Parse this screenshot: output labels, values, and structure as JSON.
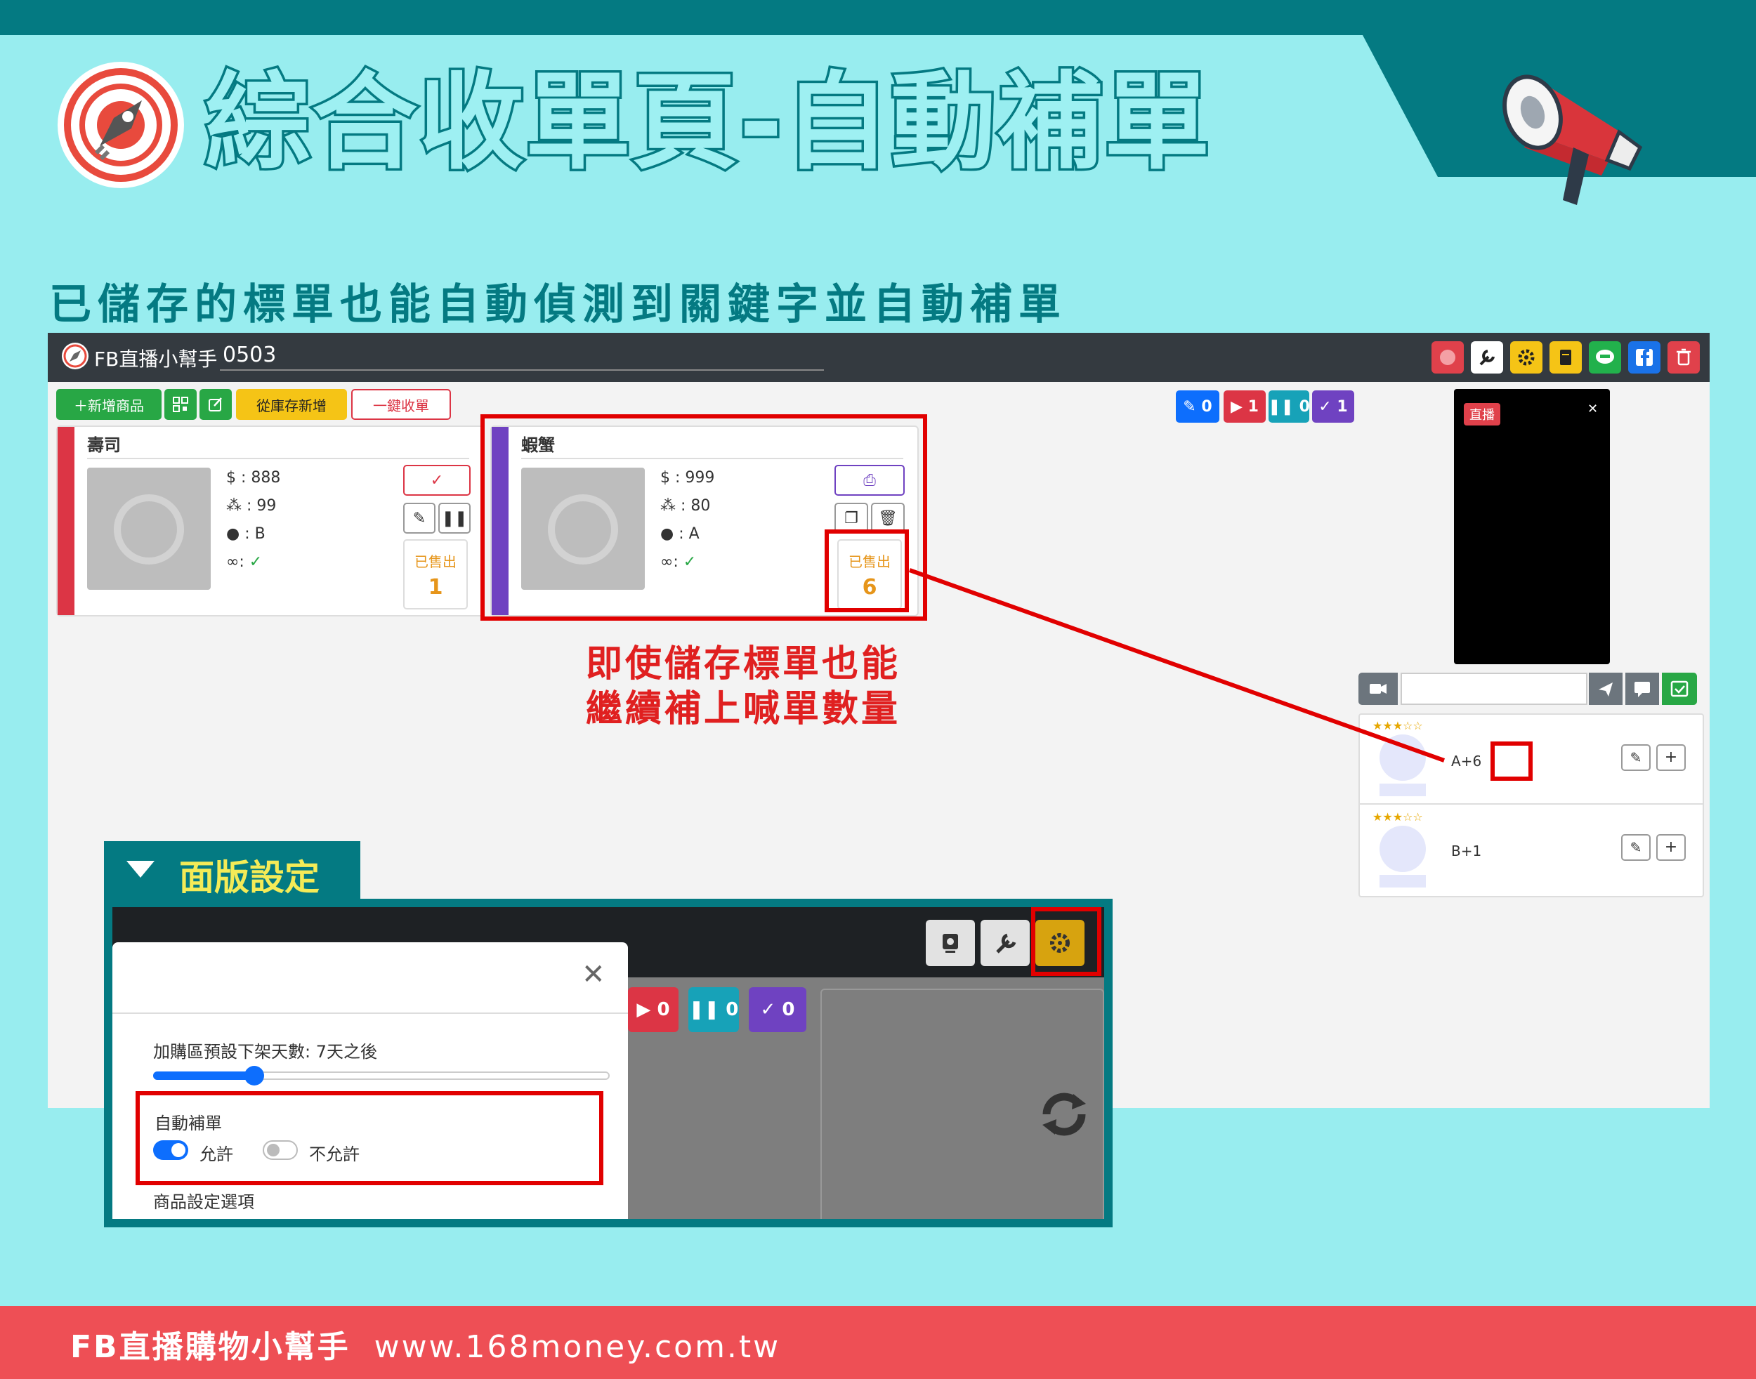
{
  "header": {
    "title": "綜合收單頁-自動補單",
    "subtitle": "已儲存的標單也能自動偵測到關鍵字並自動補單"
  },
  "app": {
    "name": "FB直播小幫手",
    "session": "0503",
    "toolbar": {
      "add_product": "＋新增商品",
      "from_stock": "從庫存新增",
      "one_click": "一鍵收單"
    },
    "counters": [
      {
        "icon": "pencil-icon",
        "value": "0",
        "color": "#0D6EFD"
      },
      {
        "icon": "play-icon",
        "value": "1",
        "color": "#DC3545"
      },
      {
        "icon": "pause-icon",
        "value": "0",
        "color": "#17A2B8"
      },
      {
        "icon": "check-icon",
        "value": "1",
        "color": "#6F42C1"
      }
    ],
    "products": [
      {
        "name": "壽司",
        "price": "888",
        "stock": "99",
        "keyword": "B",
        "sold_label": "已售出",
        "sold": "1",
        "color": "#DC3545"
      },
      {
        "name": "蝦蟹",
        "price": "999",
        "stock": "80",
        "keyword": "A",
        "sold_label": "已售出",
        "sold": "6",
        "color": "#6F42C1"
      }
    ],
    "live_badge": "直播",
    "comments": [
      {
        "stars": "★★★☆☆",
        "text": "A+6"
      },
      {
        "stars": "★★★☆☆",
        "text": "B+1"
      }
    ]
  },
  "annotation": {
    "line1": "即使儲存標單也能",
    "line2": "繼續補上喊單數量"
  },
  "panel": {
    "tab_label": "面版設定",
    "slider_label": "加購區預設下架天數: 7天之後",
    "slider_value": 0.22,
    "auto_fill_label": "自動補單",
    "allow": "允許",
    "deny": "不允許",
    "product_settings": "商品設定選項",
    "counters": [
      {
        "value": "0",
        "color": "#DC3545"
      },
      {
        "value": "0",
        "color": "#17A2B8"
      },
      {
        "value": "0",
        "color": "#6F42C1"
      }
    ]
  },
  "footer": {
    "brand": "FB直播購物小幫手",
    "url": "www.168money.com.tw"
  }
}
